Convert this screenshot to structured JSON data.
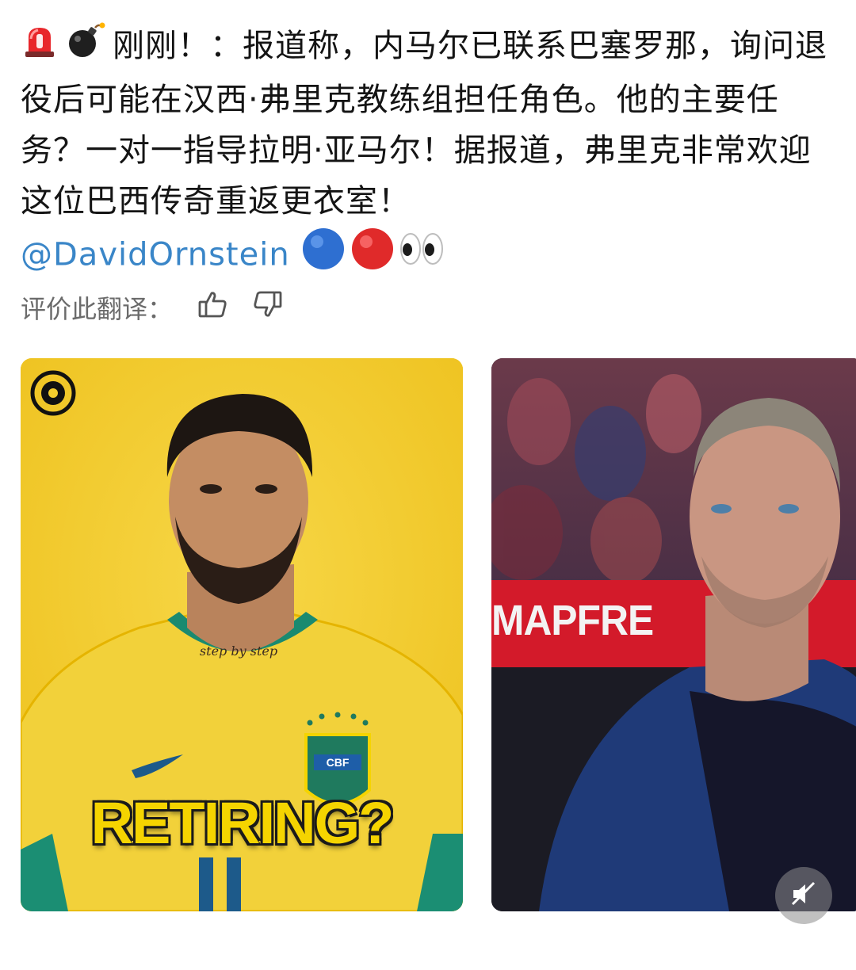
{
  "post": {
    "lead_emojis": [
      "rotating-light",
      "bomb"
    ],
    "text": "刚刚！：报道称，内马尔已联系巴塞罗那，询问退役后可能在汉西·弗里克教练组担任角色。他的主要任务？一对一指导拉明·亚马尔！据报道，弗里克非常欢迎这位巴西传奇重返更衣室！",
    "mention": "@DavidOrnstein",
    "trailing_emojis": [
      "blue-circle",
      "red-circle",
      "eyes"
    ]
  },
  "rating": {
    "label": "评价此翻译："
  },
  "images": {
    "left": {
      "caption": "RETIRING?",
      "shirt_badge": "CBF",
      "neck_text": "step by step",
      "bg_color": "#f3cd2d"
    },
    "right": {
      "banner_text": "MAPFRE",
      "mute_icon": "speaker-muted-icon"
    }
  },
  "colors": {
    "mention": "#3a86c8",
    "text": "#141414",
    "muted": "#6b6b6b"
  }
}
